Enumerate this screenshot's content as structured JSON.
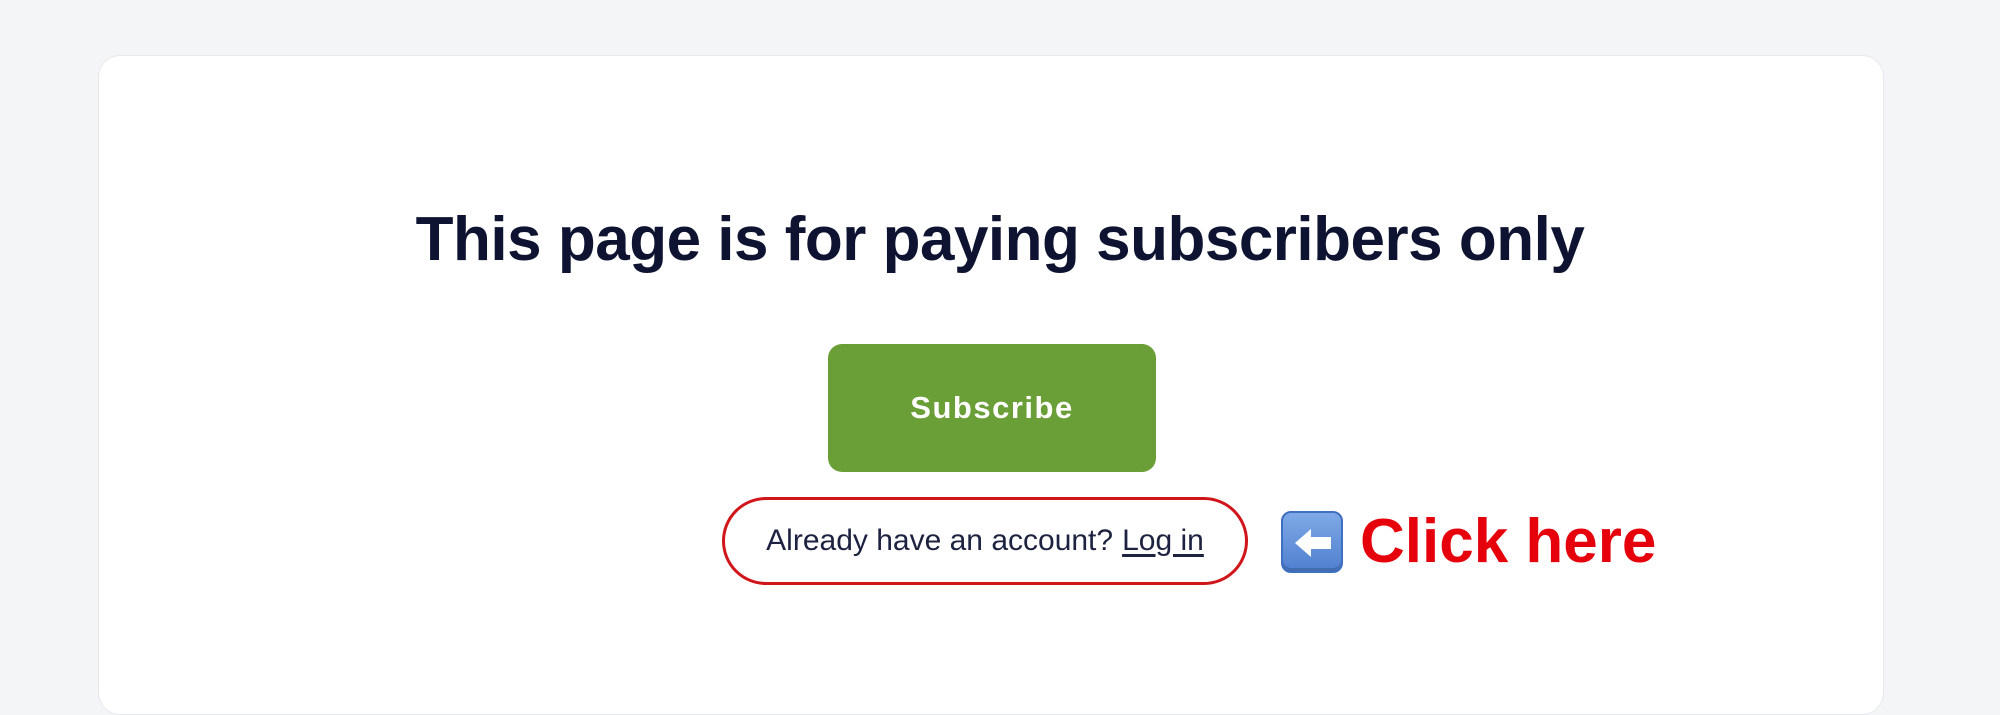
{
  "paywall": {
    "headline": "This page is for paying subscribers only",
    "subscribe_label": "Subscribe",
    "login_prompt": "Already have an account?",
    "login_link": "Log in"
  },
  "annotation": {
    "icon": "left-arrow-icon",
    "label": "Click here",
    "highlight_color": "#d0151b",
    "label_color": "#e6000b"
  },
  "colors": {
    "page_background": "#f4f5f7",
    "card_background": "#ffffff",
    "headline": "#0d1330",
    "subscribe_button": "#6a9e37"
  }
}
